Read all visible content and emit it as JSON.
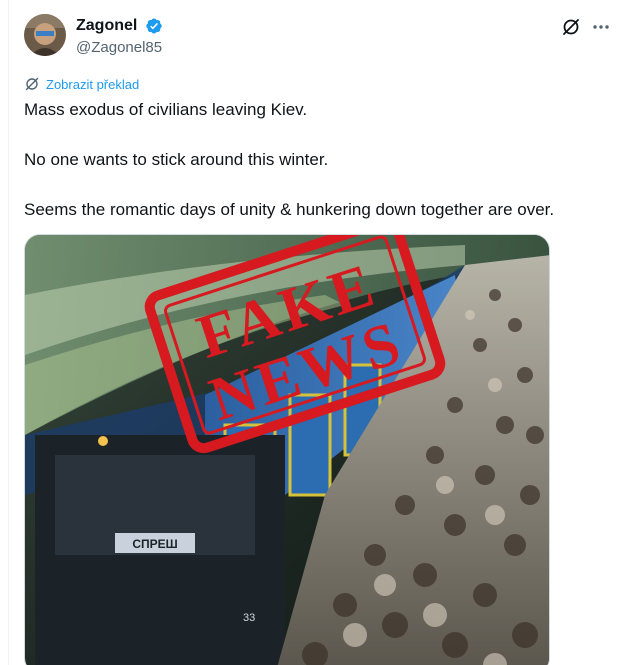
{
  "author": {
    "display_name": "Zagonel",
    "handle": "@Zagonel85"
  },
  "icons": {
    "verified": "verified-badge-icon",
    "grok": "grok-icon",
    "more": "more-icon",
    "translate": "translate-icon"
  },
  "translate_label": "Zobrazit překlad",
  "tweet": {
    "line1": "Mass exodus of civilians leaving Kiev.",
    "line2": "No one wants to stick around this winter.",
    "line3": "Seems the romantic days of unity & hunkering down together are over."
  },
  "media": {
    "stamp_line1": "FAKE",
    "stamp_line2": "NEWS",
    "train_sign": "СПРЕШ",
    "train_number": "33"
  },
  "colors": {
    "accent": "#1d9bf0",
    "stamp": "#d71920"
  }
}
